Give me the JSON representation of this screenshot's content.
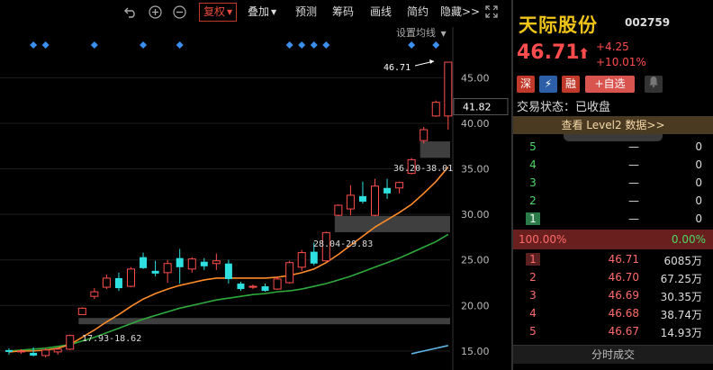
{
  "toolbar": {
    "icons": [
      "undo-icon",
      "zoom-in-icon",
      "zoom-out-icon",
      "fullscreen-icon"
    ],
    "fuquan": "复权",
    "diejia": "叠加",
    "yuce": "预测",
    "chouma": "筹码",
    "huaxian": "画线",
    "jianyue": "简约",
    "yincang": "隐藏>>"
  },
  "ma_settings_label": "设置均线",
  "price_axis": {
    "ticks": [
      "45.00",
      "40.00",
      "35.00",
      "30.00",
      "25.00",
      "20.00",
      "15.00"
    ],
    "current_label": "41.82"
  },
  "annotations": {
    "high_label": "46.71",
    "gap1": "36.20-38.01",
    "gap2": "28.04-29.83",
    "gap3": "17.93-18.62"
  },
  "chart_data": {
    "type": "candlestick",
    "ylim": [
      14,
      48
    ],
    "candles": [
      {
        "o": 15.1,
        "h": 15.3,
        "l": 14.6,
        "c": 14.9
      },
      {
        "o": 14.9,
        "h": 15.2,
        "l": 14.7,
        "c": 15.0
      },
      {
        "o": 14.8,
        "h": 15.4,
        "l": 14.4,
        "c": 14.5
      },
      {
        "o": 14.5,
        "h": 15.3,
        "l": 14.3,
        "c": 15.1
      },
      {
        "o": 14.9,
        "h": 15.4,
        "l": 14.6,
        "c": 15.2
      },
      {
        "o": 15.2,
        "h": 16.8,
        "l": 15.1,
        "c": 16.7
      },
      {
        "o": 19.0,
        "h": 19.8,
        "l": 19.0,
        "c": 19.7
      },
      {
        "o": 21.0,
        "h": 21.9,
        "l": 20.7,
        "c": 21.5
      },
      {
        "o": 22.0,
        "h": 23.4,
        "l": 21.8,
        "c": 23.0
      },
      {
        "o": 23.0,
        "h": 23.6,
        "l": 21.6,
        "c": 21.9
      },
      {
        "o": 22.1,
        "h": 24.2,
        "l": 22.0,
        "c": 24.0
      },
      {
        "o": 25.3,
        "h": 25.8,
        "l": 24.0,
        "c": 24.1
      },
      {
        "o": 23.8,
        "h": 24.9,
        "l": 23.2,
        "c": 23.5
      },
      {
        "o": 23.6,
        "h": 25.0,
        "l": 22.5,
        "c": 24.6
      },
      {
        "o": 25.2,
        "h": 26.2,
        "l": 22.4,
        "c": 24.2
      },
      {
        "o": 24.0,
        "h": 25.3,
        "l": 23.6,
        "c": 25.1
      },
      {
        "o": 24.8,
        "h": 25.2,
        "l": 23.9,
        "c": 24.3
      },
      {
        "o": 24.6,
        "h": 25.7,
        "l": 23.9,
        "c": 24.9
      },
      {
        "o": 24.6,
        "h": 25.0,
        "l": 22.4,
        "c": 22.9
      },
      {
        "o": 22.4,
        "h": 22.6,
        "l": 21.6,
        "c": 21.8
      },
      {
        "o": 22.0,
        "h": 22.3,
        "l": 21.8,
        "c": 22.1
      },
      {
        "o": 22.1,
        "h": 22.4,
        "l": 21.5,
        "c": 21.6
      },
      {
        "o": 21.8,
        "h": 23.2,
        "l": 21.7,
        "c": 22.9
      },
      {
        "o": 22.5,
        "h": 24.9,
        "l": 22.4,
        "c": 24.7
      },
      {
        "o": 24.2,
        "h": 26.1,
        "l": 23.8,
        "c": 25.8
      },
      {
        "o": 25.9,
        "h": 26.9,
        "l": 24.4,
        "c": 24.6
      },
      {
        "o": 24.9,
        "h": 28.1,
        "l": 24.8,
        "c": 28.0
      },
      {
        "o": 29.9,
        "h": 31.1,
        "l": 29.8,
        "c": 31.0
      },
      {
        "o": 30.6,
        "h": 33.2,
        "l": 29.9,
        "c": 32.1
      },
      {
        "o": 32.0,
        "h": 33.6,
        "l": 31.2,
        "c": 31.4
      },
      {
        "o": 29.9,
        "h": 33.9,
        "l": 29.8,
        "c": 33.1
      },
      {
        "o": 32.9,
        "h": 33.9,
        "l": 31.7,
        "c": 32.3
      },
      {
        "o": 32.9,
        "h": 33.6,
        "l": 32.3,
        "c": 33.5
      },
      {
        "o": 34.5,
        "h": 36.2,
        "l": 34.4,
        "c": 36.0
      },
      {
        "o": 38.1,
        "h": 39.6,
        "l": 37.8,
        "c": 39.3
      },
      {
        "o": 40.8,
        "h": 42.5,
        "l": 40.7,
        "c": 42.3
      },
      {
        "o": 40.8,
        "h": 46.71,
        "l": 39.3,
        "c": 46.71
      }
    ],
    "gaps": [
      {
        "lo": 36.2,
        "hi": 38.01,
        "from": 34
      },
      {
        "lo": 28.04,
        "hi": 29.83,
        "from": 27
      },
      {
        "lo": 17.93,
        "hi": 18.62,
        "from": 6
      }
    ],
    "ma_orange": [
      14.9,
      15.0,
      15.0,
      15.1,
      15.3,
      15.7,
      16.5,
      17.3,
      18.2,
      19.0,
      19.9,
      20.7,
      21.3,
      21.8,
      22.2,
      22.5,
      22.8,
      23.0,
      23.0,
      23.0,
      23.0,
      23.0,
      23.1,
      23.3,
      23.6,
      24.0,
      24.7,
      25.6,
      26.6,
      27.6,
      28.6,
      29.4,
      30.2,
      31.1,
      32.3,
      33.6,
      35.2
    ],
    "ma_green": [
      15.0,
      15.1,
      15.2,
      15.3,
      15.5,
      15.7,
      16.1,
      16.5,
      17.0,
      17.5,
      18.0,
      18.5,
      18.9,
      19.3,
      19.7,
      20.0,
      20.3,
      20.6,
      20.8,
      21.0,
      21.2,
      21.3,
      21.5,
      21.6,
      21.8,
      22.1,
      22.4,
      22.8,
      23.2,
      23.7,
      24.2,
      24.7,
      25.2,
      25.8,
      26.4,
      27.0,
      27.8
    ],
    "ma_blue_tail": [
      14.7,
      15.0,
      15.3,
      15.6
    ]
  },
  "stock": {
    "name": "天际股份",
    "code": "002759",
    "price": "46.71",
    "arrow": "⬆",
    "change": "+4.25",
    "change_pct": "+10.01%"
  },
  "tags": {
    "shen": "深",
    "flash": "⚡",
    "rong": "融",
    "add": "+自选",
    "bell": "bell-icon"
  },
  "status": "交易状态：已收盘",
  "level2": "查看 Level2 数据>>",
  "sell_rows": [
    {
      "n": "5",
      "price": "—",
      "vol": "0"
    },
    {
      "n": "4",
      "price": "—",
      "vol": "0"
    },
    {
      "n": "3",
      "price": "—",
      "vol": "0"
    },
    {
      "n": "2",
      "price": "—",
      "vol": "0"
    },
    {
      "n": "1",
      "price": "—",
      "vol": "0"
    }
  ],
  "ratio": {
    "left": "100.00%",
    "right": "0.00%",
    "fill": 1.0
  },
  "buy_rows": [
    {
      "n": "1",
      "price": "46.71",
      "vol": "6085万"
    },
    {
      "n": "2",
      "price": "46.70",
      "vol": "67.25万"
    },
    {
      "n": "3",
      "price": "46.69",
      "vol": "30.35万"
    },
    {
      "n": "4",
      "price": "46.68",
      "vol": "38.74万"
    },
    {
      "n": "5",
      "price": "46.67",
      "vol": "14.93万"
    }
  ],
  "fenshi": "分时成交"
}
